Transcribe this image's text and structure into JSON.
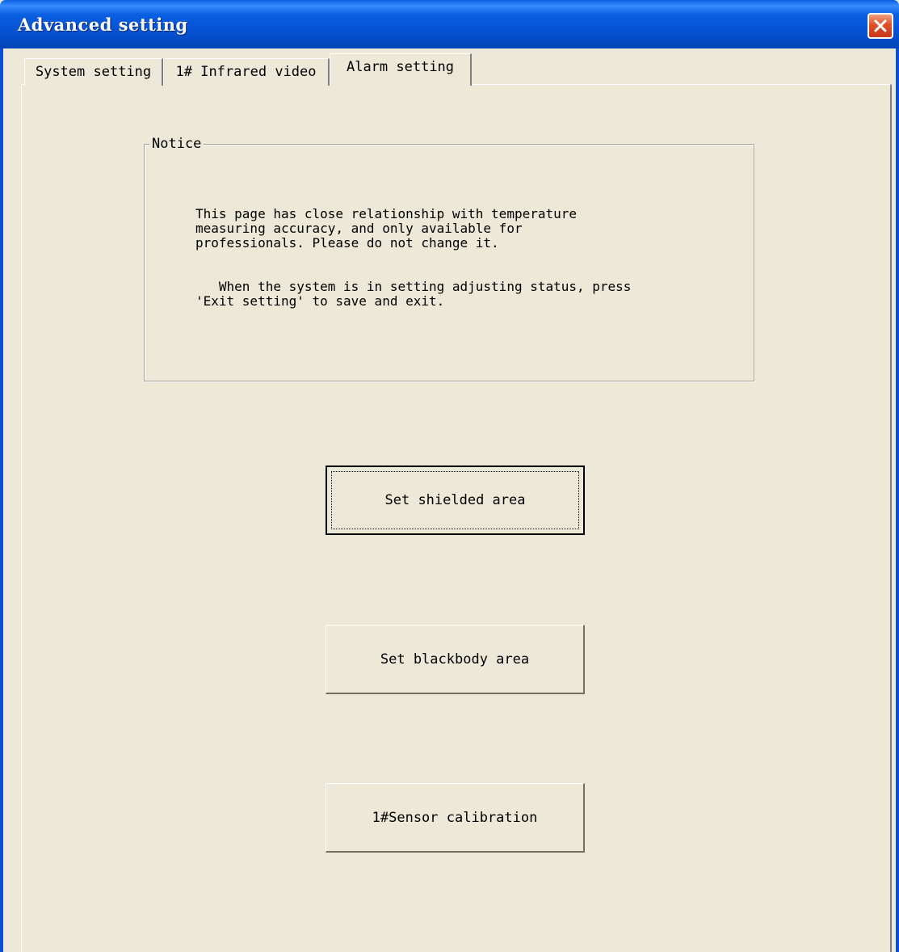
{
  "window": {
    "title": "Advanced setting"
  },
  "tabs": [
    {
      "label": "System setting",
      "active": false
    },
    {
      "label": "1# Infrared video",
      "active": false
    },
    {
      "label": "Alarm setting",
      "active": true
    }
  ],
  "notice": {
    "legend": "Notice",
    "paragraph1": "This page has close relationship with temperature\nmeasuring accuracy, and only available for\nprofessionals. Please do not change it.",
    "paragraph2": "   When the system is in setting adjusting status, press\n'Exit setting' to save and exit."
  },
  "buttons": {
    "shielded": "Set shielded area",
    "blackbody": "Set blackbody area",
    "calibration": "1#Sensor calibration"
  },
  "colors": {
    "titlebar": "#0a5fe0",
    "background": "#ece9d8",
    "close_button": "#e0502a"
  }
}
